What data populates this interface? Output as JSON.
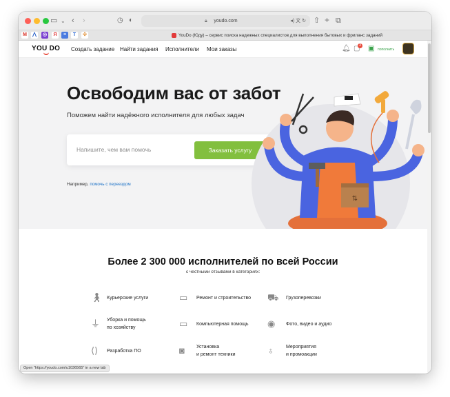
{
  "browser": {
    "url": "youdo.com",
    "tab_title": "YouDo (Юду) – сервис поиска надежных специалистов для выполнения бытовых и фриланс заданий",
    "status_text": "Open \"https://youdo.com/u1036565\" in a new tab"
  },
  "header": {
    "logo": "YOU DO",
    "nav": [
      "Создать задание",
      "Найти задания",
      "Исполнители",
      "Мои заказы"
    ],
    "notification_count": "3",
    "topup_label": "пополнить"
  },
  "hero": {
    "title": "Освободим вас от забот",
    "subtitle": "Поможем найти надёжного исполнителя для любых задач",
    "search_placeholder": "Напишите, чем вам помочь",
    "order_button": "Заказать услугу",
    "example_prefix": "Например, ",
    "example_link": "помочь с переездом"
  },
  "stats": {
    "title": "Более 2 300 000 исполнителей по всей России",
    "subtitle": "с честными отзывами в категориях:"
  },
  "categories": [
    {
      "label": "Курьерские услуги",
      "icon": "courier-icon"
    },
    {
      "label": "Ремонт и строительство",
      "icon": "paint-roller-icon"
    },
    {
      "label": "Грузоперевозки",
      "icon": "truck-icon"
    },
    {
      "label": "Уборка и помощь\nпо хозяйству",
      "icon": "cleaning-icon"
    },
    {
      "label": "Компьютерная помощь",
      "icon": "monitor-icon"
    },
    {
      "label": "Фото, видео и аудио",
      "icon": "camera-icon"
    },
    {
      "label": "Разработка ПО",
      "icon": "code-icon"
    },
    {
      "label": "Установка\nи ремонт техники",
      "icon": "washing-machine-icon"
    },
    {
      "label": "Мероприятия\nи промоакции",
      "icon": "balloon-icon"
    }
  ],
  "colors": {
    "accent_green": "#82bf3e",
    "link_blue": "#1f73c7",
    "hero_bg": "#f3f3f4",
    "character_shirt": "#4a64e0"
  }
}
